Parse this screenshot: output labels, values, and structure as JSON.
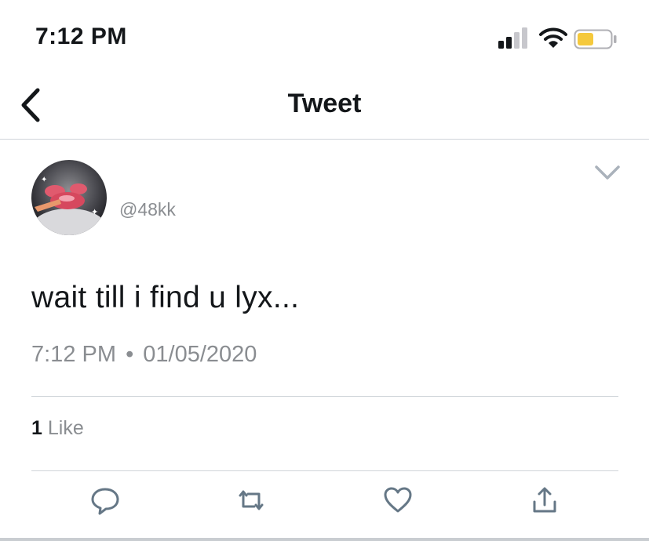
{
  "status_bar": {
    "time": "7:12 PM"
  },
  "nav": {
    "title": "Tweet"
  },
  "tweet": {
    "handle": "@48kk",
    "text": "wait till i find u lyx...",
    "time": "7:12 PM",
    "separator": "•",
    "date": "01/05/2020",
    "likes_count": "1",
    "likes_label": "Like"
  },
  "icons": {
    "back": "chevron-left-icon",
    "menu": "chevron-down-icon",
    "reply": "comment-icon",
    "retweet": "retweet-icon",
    "like": "heart-icon",
    "share": "share-icon"
  },
  "colors": {
    "text": "#14171a",
    "secondary": "#8a8d91",
    "divider": "#cfd4d9",
    "battery": "#f5c93d",
    "action_icon": "#657786"
  }
}
